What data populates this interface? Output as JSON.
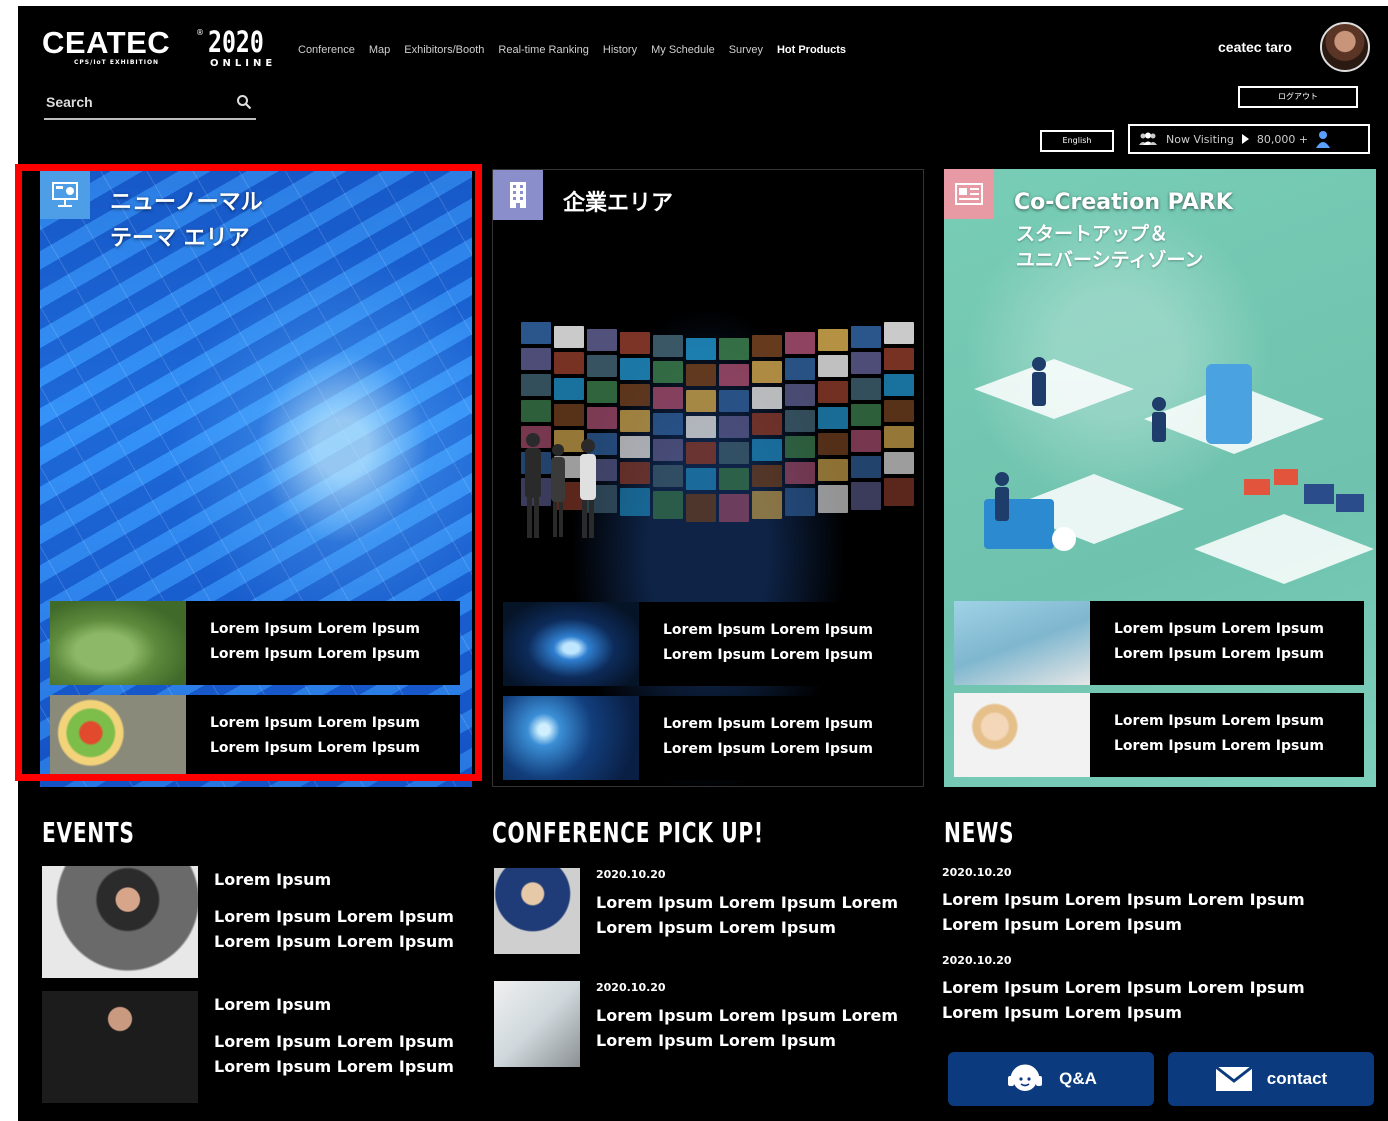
{
  "brand": {
    "name": "CEATEC",
    "reg": "®",
    "subtitle": "CPS/IoT EXHIBITION",
    "year": "2020",
    "edition": "ONLINE"
  },
  "nav": {
    "items": [
      "Conference",
      "Map",
      "Exhibitors/Booth",
      "Real-time Ranking",
      "History",
      "My Schedule",
      "Survey",
      "Hot Products"
    ]
  },
  "search": {
    "placeholder": "Search"
  },
  "user": {
    "name": "ceatec taro",
    "logout_label": "ログアウト"
  },
  "language": {
    "label": "English"
  },
  "visitors": {
    "label": "Now Visiting",
    "count": "80,000 +"
  },
  "panels": [
    {
      "title": "ニューノーマル\nテーマ エリア",
      "icon": "presentation-board-icon",
      "cards": [
        {
          "text": "Lorem Ipsum Lorem Ipsum\nLorem Ipsum Lorem Ipsum"
        },
        {
          "text": "Lorem Ipsum Lorem Ipsum\nLorem Ipsum Lorem Ipsum"
        }
      ]
    },
    {
      "title": "企業エリア",
      "icon": "building-icon",
      "cards": [
        {
          "text": "Lorem Ipsum Lorem Ipsum\nLorem Ipsum Lorem Ipsum"
        },
        {
          "text": "Lorem Ipsum Lorem Ipsum\nLorem Ipsum Lorem Ipsum"
        }
      ]
    },
    {
      "title": "Co-Creation PARK",
      "subtitle": "スタートアップ＆\nユニバーシティゾーン",
      "icon": "newspaper-icon",
      "cards": [
        {
          "text": "Lorem Ipsum Lorem Ipsum\nLorem Ipsum Lorem Ipsum"
        },
        {
          "text": "Lorem Ipsum Lorem Ipsum\nLorem Ipsum Lorem Ipsum"
        }
      ]
    }
  ],
  "events": {
    "title": "EVENTS",
    "items": [
      {
        "title": "Lorem Ipsum",
        "text": "Lorem Ipsum Lorem Ipsum\nLorem Ipsum Lorem Ipsum"
      },
      {
        "title": "Lorem Ipsum",
        "text": "Lorem Ipsum Lorem Ipsum\nLorem Ipsum Lorem Ipsum"
      }
    ]
  },
  "conference": {
    "title": "CONFERENCE PICK UP!",
    "items": [
      {
        "date": "2020.10.20",
        "text": "Lorem Ipsum Lorem Ipsum Lorem\nLorem Ipsum Lorem Ipsum"
      },
      {
        "date": "2020.10.20",
        "text": "Lorem Ipsum Lorem Ipsum Lorem\nLorem Ipsum Lorem Ipsum"
      }
    ]
  },
  "news": {
    "title": "NEWS",
    "items": [
      {
        "date": "2020.10.20",
        "text": "Lorem Ipsum Lorem Ipsum Lorem Ipsum\nLorem Ipsum Lorem Ipsum"
      },
      {
        "date": "2020.10.20",
        "text": "Lorem Ipsum Lorem Ipsum Lorem Ipsum\nLorem Ipsum Lorem Ipsum"
      }
    ]
  },
  "buttons": {
    "qa": "Q&A",
    "contact": "contact"
  },
  "colors": {
    "background": "#000000",
    "highlight": "#ff0000",
    "button_blue": "#0b3a7e",
    "panel1_icon": "#4d9ee6",
    "panel2_icon": "#8a8fcb",
    "panel3_icon": "#e89aa4",
    "panel3_bg": "#78cdb6"
  }
}
